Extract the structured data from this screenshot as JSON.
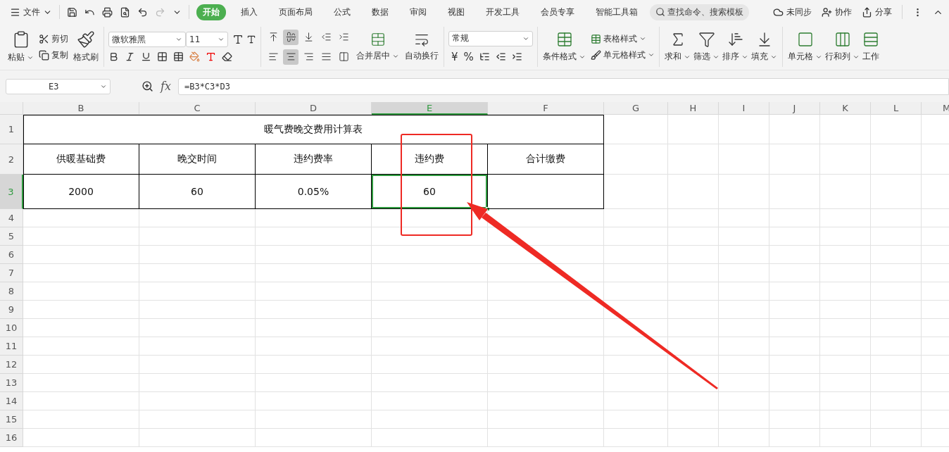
{
  "menu_bar": {
    "file_menu": "文件",
    "tabs": [
      {
        "label": "开始",
        "selected": true
      },
      {
        "label": "插入",
        "selected": false
      },
      {
        "label": "页面布局",
        "selected": false
      },
      {
        "label": "公式",
        "selected": false
      },
      {
        "label": "数据",
        "selected": false
      },
      {
        "label": "审阅",
        "selected": false
      },
      {
        "label": "视图",
        "selected": false
      },
      {
        "label": "开发工具",
        "selected": false
      },
      {
        "label": "会员专享",
        "selected": false
      },
      {
        "label": "智能工具箱",
        "selected": false
      }
    ],
    "search": {
      "placeholder": "查找命令、搜索模板"
    },
    "actions": [
      {
        "kind": "sync",
        "label": "未同步"
      },
      {
        "kind": "collab",
        "label": "协作"
      },
      {
        "kind": "share",
        "label": "分享"
      }
    ]
  },
  "ribbon": {
    "clipboard": [
      {
        "kind": "paste",
        "label": "粘贴"
      },
      {
        "kind": "cut",
        "label": "剪切"
      },
      {
        "kind": "copy",
        "label": "复制"
      },
      {
        "kind": "painter",
        "label": "格式刷"
      }
    ],
    "font": {
      "name": "微软雅黑",
      "size": "11"
    },
    "align": [
      {
        "kind": "top",
        "selected": false
      },
      {
        "kind": "middle",
        "selected": true
      },
      {
        "kind": "bottom",
        "selected": false
      },
      {
        "kind": "outdent",
        "selected": false
      },
      {
        "kind": "indent",
        "selected": false
      },
      {
        "kind": "left",
        "selected": false
      },
      {
        "kind": "center",
        "selected": true
      },
      {
        "kind": "right",
        "selected": false
      },
      {
        "kind": "justify",
        "selected": false
      },
      {
        "kind": "distribute",
        "selected": false
      }
    ],
    "merge": "合并居中",
    "wrap": "自动换行",
    "number_format": "常规",
    "number_symbols": [
      "¥",
      "%"
    ],
    "styles": [
      {
        "kind": "conditional",
        "label": "条件格式"
      },
      {
        "kind": "table",
        "label": "表格样式"
      },
      {
        "kind": "cell",
        "label": "单元格样式"
      }
    ],
    "tools": [
      {
        "kind": "sum",
        "label": "求和"
      },
      {
        "kind": "filter",
        "label": "筛选"
      },
      {
        "kind": "sort",
        "label": "排序"
      },
      {
        "kind": "fill",
        "label": "填充"
      },
      {
        "kind": "cells",
        "label": "单元格"
      },
      {
        "kind": "rowcol",
        "label": "行和列"
      },
      {
        "kind": "sheet",
        "label": "工作"
      }
    ]
  },
  "formula_bar": {
    "name_box": "E3",
    "function_label": "fx",
    "formula": "=B3*C3*D3"
  },
  "sheet": {
    "columns": [
      {
        "label": "B",
        "selected": false
      },
      {
        "label": "C",
        "selected": false
      },
      {
        "label": "D",
        "selected": false
      },
      {
        "label": "E",
        "selected": true
      },
      {
        "label": "F",
        "selected": false
      },
      {
        "label": "G",
        "selected": false
      },
      {
        "label": "H",
        "selected": false
      },
      {
        "label": "I",
        "selected": false
      },
      {
        "label": "J",
        "selected": false
      },
      {
        "label": "K",
        "selected": false
      },
      {
        "label": "L",
        "selected": false
      },
      {
        "label": "M",
        "selected": false
      }
    ],
    "rows": [
      {
        "label": "1",
        "selected": false
      },
      {
        "label": "2",
        "selected": false
      },
      {
        "label": "3",
        "selected": true
      },
      {
        "label": "4",
        "selected": false
      },
      {
        "label": "5",
        "selected": false
      },
      {
        "label": "6",
        "selected": false
      },
      {
        "label": "7",
        "selected": false
      },
      {
        "label": "8",
        "selected": false
      },
      {
        "label": "9",
        "selected": false
      },
      {
        "label": "10",
        "selected": false
      },
      {
        "label": "11",
        "selected": false
      },
      {
        "label": "12",
        "selected": false
      },
      {
        "label": "13",
        "selected": false
      },
      {
        "label": "14",
        "selected": false
      },
      {
        "label": "15",
        "selected": false
      },
      {
        "label": "16",
        "selected": false
      }
    ],
    "title": "暖气费晚交费用计算表",
    "headers": [
      "供暖基础费",
      "晚交时间",
      "违约费率",
      "违约费",
      "合计缴费"
    ],
    "values": [
      {
        "text": "2000",
        "selected": false
      },
      {
        "text": "60",
        "selected": false
      },
      {
        "text": "0.05%",
        "selected": false
      },
      {
        "text": "60",
        "selected": true
      }
    ]
  }
}
